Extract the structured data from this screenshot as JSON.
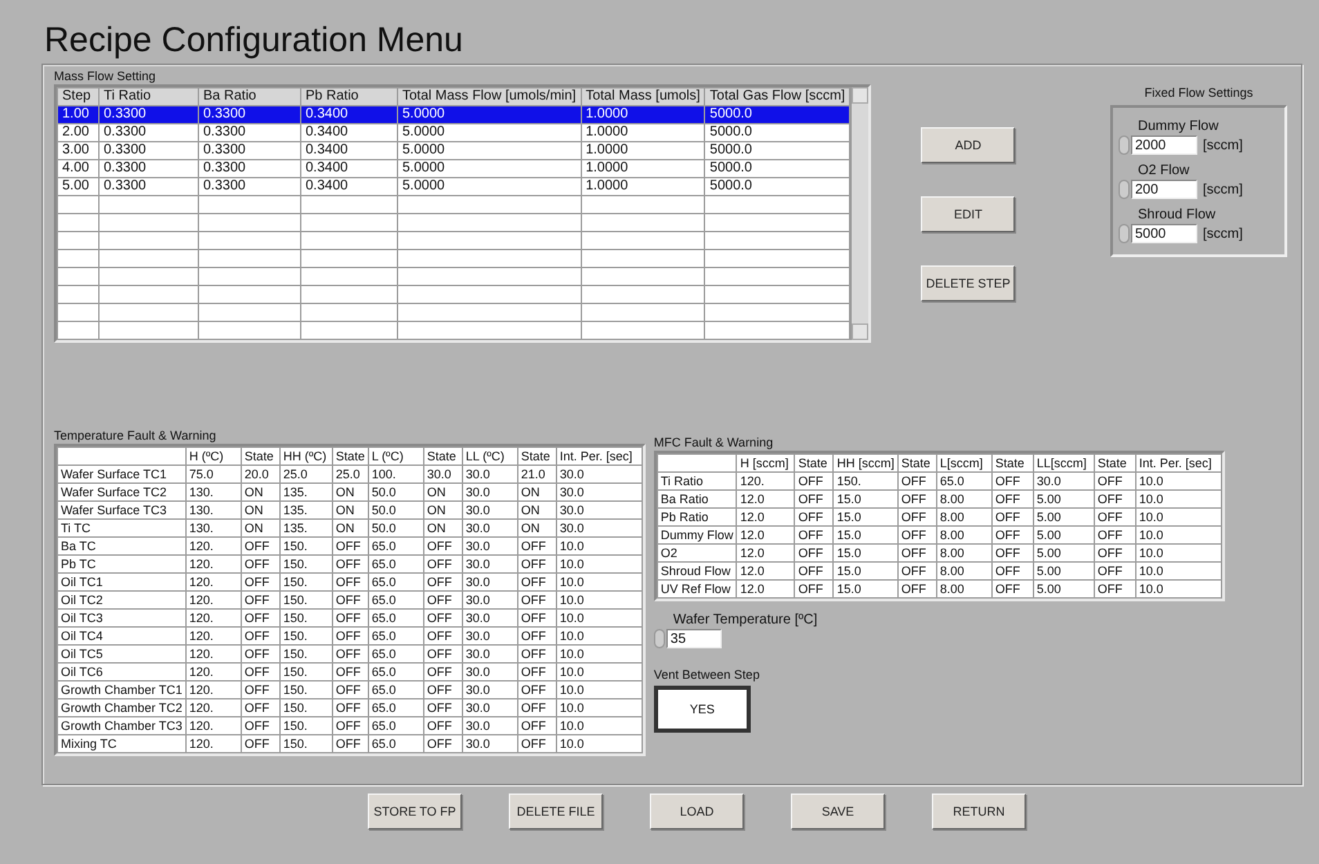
{
  "window": {
    "title": "Recipe Configuration Menu"
  },
  "mass_flow": {
    "label": "Mass Flow Setting",
    "columns": [
      "Step",
      "Ti Ratio",
      "Ba Ratio",
      "Pb Ratio",
      "Total Mass Flow [umols/min]",
      "Total Mass [umols]",
      "Total Gas Flow [sccm]"
    ],
    "rows": [
      {
        "cells": [
          "1.00",
          "0.3300",
          "0.3300",
          "0.3400",
          "5.0000",
          "1.0000",
          "5000.0"
        ],
        "selected": true
      },
      {
        "cells": [
          "2.00",
          "0.3300",
          "0.3300",
          "0.3400",
          "5.0000",
          "1.0000",
          "5000.0"
        ],
        "selected": false
      },
      {
        "cells": [
          "3.00",
          "0.3300",
          "0.3300",
          "0.3400",
          "5.0000",
          "1.0000",
          "5000.0"
        ],
        "selected": false
      },
      {
        "cells": [
          "4.00",
          "0.3300",
          "0.3300",
          "0.3400",
          "5.0000",
          "1.0000",
          "5000.0"
        ],
        "selected": false
      },
      {
        "cells": [
          "5.00",
          "0.3300",
          "0.3300",
          "0.3400",
          "5.0000",
          "1.0000",
          "5000.0"
        ],
        "selected": false
      }
    ]
  },
  "step_buttons": [
    "ADD",
    "EDIT",
    "DELETE STEP"
  ],
  "fixed_flow": {
    "label": "Fixed Flow Settings",
    "fields": [
      {
        "label": "Dummy Flow",
        "value": "2000",
        "unit": "[sccm]"
      },
      {
        "label": "O2 Flow",
        "value": "200",
        "unit": "[sccm]"
      },
      {
        "label": "Shroud Flow",
        "value": "5000",
        "unit": "[sccm]"
      }
    ]
  },
  "temperature": {
    "label": "Temperature Fault & Warning",
    "columns": [
      "",
      "H (ºC)",
      "State",
      "HH (ºC)",
      "State",
      "L (ºC)",
      "State",
      "LL (ºC)",
      "State",
      "Int. Per. [sec]"
    ],
    "rows": [
      [
        "Wafer Surface TC1",
        "75.0",
        "20.0",
        "25.0",
        "25.0",
        "100.",
        "30.0",
        "30.0",
        "21.0",
        "30.0"
      ],
      [
        "Wafer Surface TC2",
        "130.",
        "ON",
        "135.",
        "ON",
        "50.0",
        "ON",
        "30.0",
        "ON",
        "30.0"
      ],
      [
        "Wafer Surface TC3",
        "130.",
        "ON",
        "135.",
        "ON",
        "50.0",
        "ON",
        "30.0",
        "ON",
        "30.0"
      ],
      [
        "Ti TC",
        "130.",
        "ON",
        "135.",
        "ON",
        "50.0",
        "ON",
        "30.0",
        "ON",
        "30.0"
      ],
      [
        "Ba TC",
        "120.",
        "OFF",
        "150.",
        "OFF",
        "65.0",
        "OFF",
        "30.0",
        "OFF",
        "10.0"
      ],
      [
        "Pb TC",
        "120.",
        "OFF",
        "150.",
        "OFF",
        "65.0",
        "OFF",
        "30.0",
        "OFF",
        "10.0"
      ],
      [
        "Oil TC1",
        "120.",
        "OFF",
        "150.",
        "OFF",
        "65.0",
        "OFF",
        "30.0",
        "OFF",
        "10.0"
      ],
      [
        "Oil TC2",
        "120.",
        "OFF",
        "150.",
        "OFF",
        "65.0",
        "OFF",
        "30.0",
        "OFF",
        "10.0"
      ],
      [
        "Oil TC3",
        "120.",
        "OFF",
        "150.",
        "OFF",
        "65.0",
        "OFF",
        "30.0",
        "OFF",
        "10.0"
      ],
      [
        "Oil TC4",
        "120.",
        "OFF",
        "150.",
        "OFF",
        "65.0",
        "OFF",
        "30.0",
        "OFF",
        "10.0"
      ],
      [
        "Oil TC5",
        "120.",
        "OFF",
        "150.",
        "OFF",
        "65.0",
        "OFF",
        "30.0",
        "OFF",
        "10.0"
      ],
      [
        "Oil TC6",
        "120.",
        "OFF",
        "150.",
        "OFF",
        "65.0",
        "OFF",
        "30.0",
        "OFF",
        "10.0"
      ],
      [
        "Growth Chamber TC1",
        "120.",
        "OFF",
        "150.",
        "OFF",
        "65.0",
        "OFF",
        "30.0",
        "OFF",
        "10.0"
      ],
      [
        "Growth Chamber TC2",
        "120.",
        "OFF",
        "150.",
        "OFF",
        "65.0",
        "OFF",
        "30.0",
        "OFF",
        "10.0"
      ],
      [
        "Growth Chamber TC3",
        "120.",
        "OFF",
        "150.",
        "OFF",
        "65.0",
        "OFF",
        "30.0",
        "OFF",
        "10.0"
      ],
      [
        "Mixing TC",
        "120.",
        "OFF",
        "150.",
        "OFF",
        "65.0",
        "OFF",
        "30.0",
        "OFF",
        "10.0"
      ]
    ]
  },
  "mfc": {
    "label": "MFC Fault & Warning",
    "columns": [
      "",
      "H [sccm]",
      "State",
      "HH [sccm]",
      "State",
      "L[sccm]",
      "State",
      "LL[sccm]",
      "State",
      "Int. Per. [sec]"
    ],
    "rows": [
      [
        "Ti Ratio",
        "120.",
        "OFF",
        "150.",
        "OFF",
        "65.0",
        "OFF",
        "30.0",
        "OFF",
        "10.0"
      ],
      [
        "Ba Ratio",
        "12.0",
        "OFF",
        "15.0",
        "OFF",
        "8.00",
        "OFF",
        "5.00",
        "OFF",
        "10.0"
      ],
      [
        "Pb Ratio",
        "12.0",
        "OFF",
        "15.0",
        "OFF",
        "8.00",
        "OFF",
        "5.00",
        "OFF",
        "10.0"
      ],
      [
        "Dummy Flow",
        "12.0",
        "OFF",
        "15.0",
        "OFF",
        "8.00",
        "OFF",
        "5.00",
        "OFF",
        "10.0"
      ],
      [
        "O2",
        "12.0",
        "OFF",
        "15.0",
        "OFF",
        "8.00",
        "OFF",
        "5.00",
        "OFF",
        "10.0"
      ],
      [
        "Shroud Flow",
        "12.0",
        "OFF",
        "15.0",
        "OFF",
        "8.00",
        "OFF",
        "5.00",
        "OFF",
        "10.0"
      ],
      [
        "UV Ref Flow",
        "12.0",
        "OFF",
        "15.0",
        "OFF",
        "8.00",
        "OFF",
        "5.00",
        "OFF",
        "10.0"
      ]
    ]
  },
  "wafer_temperature": {
    "label": "Wafer Temperature  [ºC]",
    "value": "35"
  },
  "vent_between_step": {
    "label": "Vent Between Step",
    "value": "YES"
  },
  "bottom_buttons": [
    "STORE TO FP",
    "DELETE FILE",
    "LOAD",
    "SAVE",
    "RETURN"
  ]
}
